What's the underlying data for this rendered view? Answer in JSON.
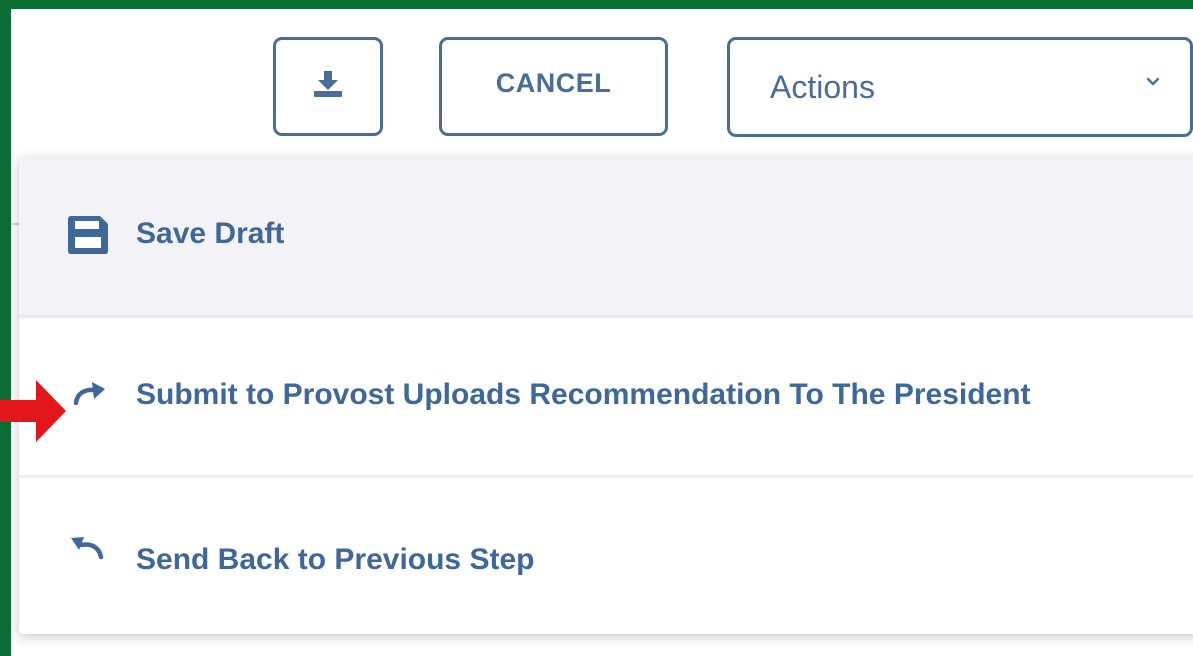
{
  "toolbar": {
    "download_icon": "download-icon",
    "cancel_label": "CANCEL",
    "actions_label": "Actions",
    "actions_chevron_icon": "chevron-down-icon"
  },
  "actions_menu": {
    "items": [
      {
        "label": "Save Draft",
        "icon": "floppy-disk-icon"
      },
      {
        "label": "Submit to Provost Uploads Recommendation To The President",
        "icon": "redo-arrow-icon"
      },
      {
        "label": "Send Back to Previous Step",
        "icon": "undo-arrow-icon"
      }
    ]
  },
  "annotation": {
    "pointer_icon": "red-arrow-icon",
    "pointer_color": "#e3161b"
  },
  "colors": {
    "frame_border": "#0a6e35",
    "accent": "#4a6d97",
    "menu_text": "#3f679a",
    "hover_row": "#f3f3f7"
  }
}
